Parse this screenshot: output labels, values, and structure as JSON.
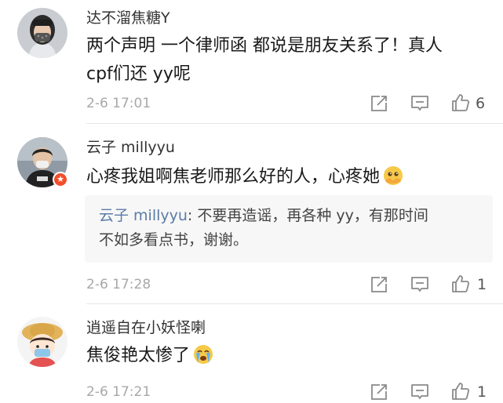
{
  "comments": [
    {
      "username": "达不溜焦糖Y",
      "text_lines": [
        "两个声明 一个律师函 都说是朋友关系了！真人",
        "cpf们还 yy呢"
      ],
      "time": "2-6 17:01",
      "like_count": "6",
      "avatar_icon": "avatar-masked-woman"
    },
    {
      "username": "云子 millyyu",
      "text_lines": [
        "心疼我姐啊焦老师那么好的人，心疼她"
      ],
      "emoji": "pleading-face-emoji",
      "reply": {
        "user": "云子 millyyu",
        "line1": ": 不要再造谣，再各种 yy，有那时间",
        "line2": "不如多看点书，谢谢。"
      },
      "time": "2-6 17:28",
      "like_count": "1",
      "avatar_icon": "avatar-young-man"
    },
    {
      "username": "逍遥自在小妖怪喇",
      "text_lines": [
        "焦俊艳太惨了"
      ],
      "emoji": "crying-face-emoji",
      "time": "2-6 17:21",
      "like_count": "1",
      "avatar_icon": "avatar-cartoon-girl"
    }
  ],
  "actions": {
    "repost_icon": "repost-icon",
    "comment_icon": "comment-icon",
    "like_icon": "thumbs-up-icon"
  },
  "colors": {
    "reply_username": "#5b7ca8",
    "vip_badge": "#f24e2b"
  }
}
